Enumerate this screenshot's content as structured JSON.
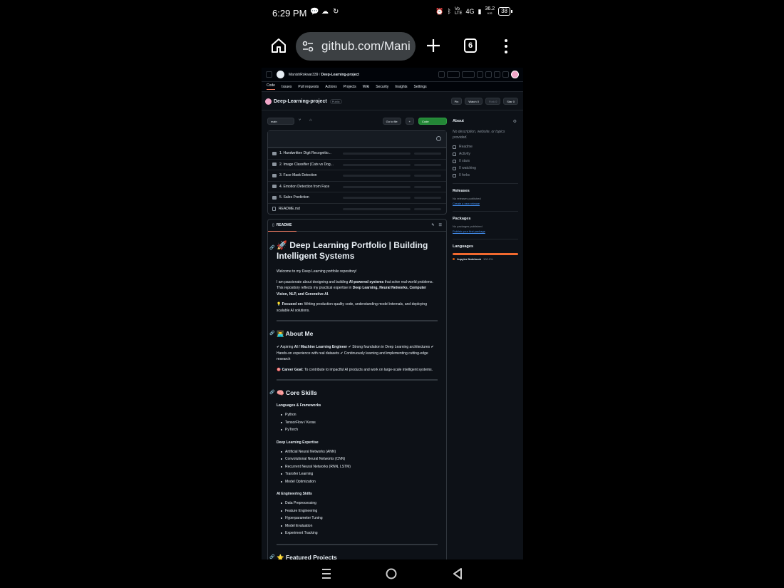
{
  "status": {
    "time": "6:29 PM",
    "network": "4G",
    "speed_top": "36.2",
    "speed_unit": "K/S",
    "battery": "38"
  },
  "browser": {
    "url": "github.com/Mani",
    "tab_count": "6"
  },
  "github": {
    "owner": "ManishRokwar339",
    "repo": "Deep-Learning-project",
    "visibility": "Public",
    "nav": [
      "Code",
      "Issues",
      "Pull requests",
      "Actions",
      "Projects",
      "Wiki",
      "Security",
      "Insights",
      "Settings"
    ],
    "actions": {
      "pin": "Pin",
      "watch": "Watch",
      "watch_count": "0",
      "fork": "Fork",
      "fork_count": "0",
      "star": "Star",
      "star_count": "0"
    },
    "branch": "main",
    "go_to_file": "Go to file",
    "code_btn": "Code",
    "files": [
      "1. Handwritten Digit Recognitio...",
      "2. Image Classifier (Cats vs Dog...",
      "3. Face Mask Detection",
      "4. Emotion Detection from Face",
      "5. Sales Prediction",
      "README.md"
    ]
  },
  "readme": {
    "tab": "README",
    "title": "🚀 Deep Learning Portfolio | Building Intelligent Systems",
    "welcome": "Welcome to my Deep Learning portfolio repository!",
    "p1_a": "I am passionate about designing and building ",
    "p1_b": "AI-powered systems",
    "p1_c": " that solve real-world problems. This repository reflects my practical expertise in ",
    "p1_d": "Deep Learning, Neural Networks, Computer Vision, NLP, and Generative AI",
    "p1_e": ".",
    "focus_label": "💡 Focused on:",
    "focus_text": " Writing production-quality code, understanding model internals, and deploying scalable AI solutions.",
    "about_h": "👨‍💻 About Me",
    "about_a": "✔ Aspiring ",
    "about_b": "AI / Machine Learning Engineer",
    "about_c": " ✔ Strong foundation in Deep Learning architectures ✔ Hands-on experience with real datasets ✔ Continuously learning and implementing cutting-edge research",
    "goal_label": "🎯 Career Goal:",
    "goal_text": " To contribute to impactful AI products and work on large-scale intelligent systems.",
    "skills_h": "🧠 Core Skills",
    "lang_h": "Languages & Frameworks",
    "langs": [
      "Python",
      "TensorFlow / Keras",
      "PyTorch"
    ],
    "dl_h": "Deep Learning Expertise",
    "dl": [
      "Artificial Neural Networks (ANN)",
      "Convolutional Neural Networks (CNN)",
      "Recurrent Neural Networks (RNN, LSTM)",
      "Transfer Learning",
      "Model Optimization"
    ],
    "ai_h": "AI Engineering Skills",
    "ai": [
      "Data Preprocessing",
      "Feature Engineering",
      "Hyperparameter Tuning",
      "Model Evaluation",
      "Experiment Tracking"
    ],
    "featured_h": "⭐ Featured Projects"
  },
  "sidebar": {
    "about": "About",
    "desc": "No description, website, or topics provided.",
    "items": [
      "Readme",
      "Activity",
      "0 stars",
      "0 watching",
      "0 forks"
    ],
    "releases": "Releases",
    "releases_none": "No releases published",
    "releases_link": "Create a new release",
    "packages": "Packages",
    "packages_none": "No packages published",
    "packages_link": "Publish your first package",
    "languages": "Languages",
    "lang_name": "Jupyter Notebook",
    "lang_pct": "100.0%",
    "lang_fraction": 1.0,
    "lang_color": "#da5b0b"
  }
}
